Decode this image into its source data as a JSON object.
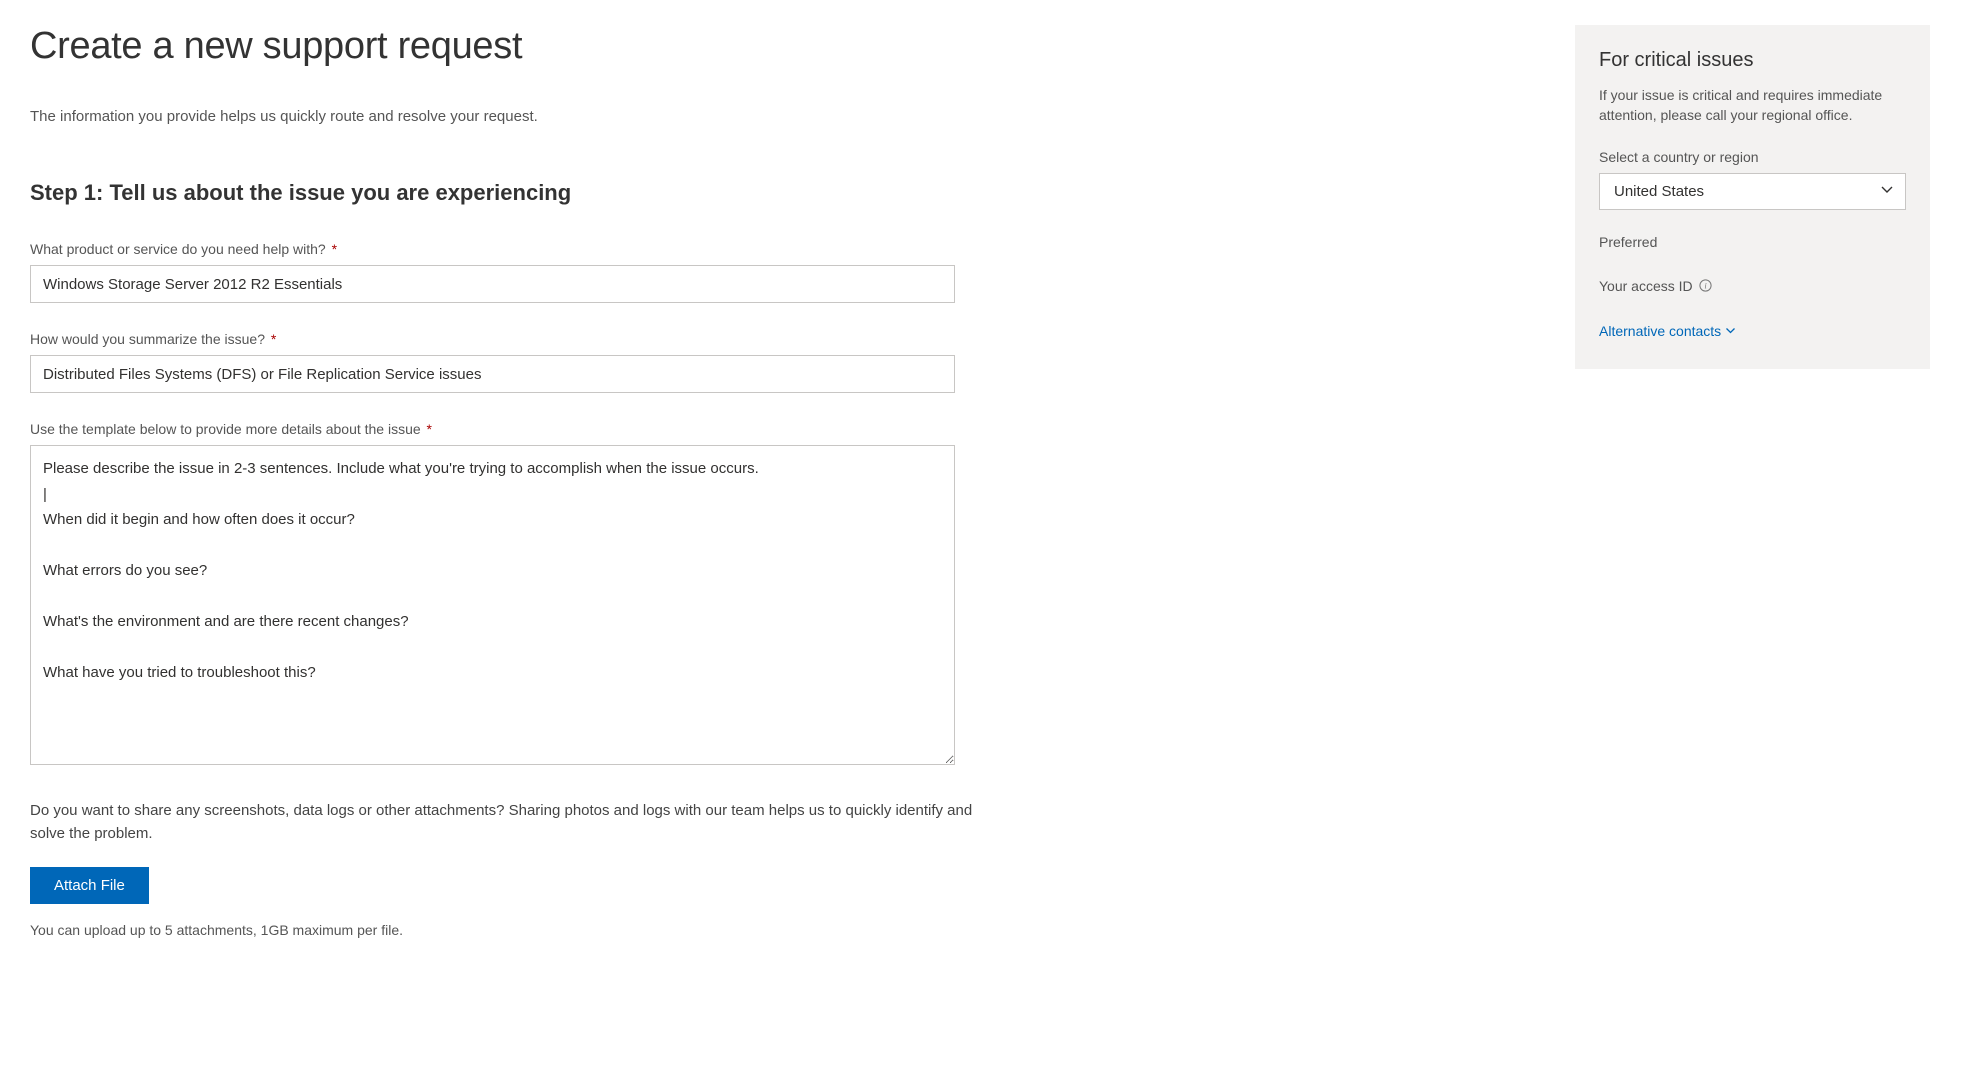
{
  "page": {
    "title": "Create a new support request",
    "subtitle": "The information you provide helps us quickly route and resolve your request."
  },
  "step1": {
    "heading": "Step 1: Tell us about the issue you are experiencing",
    "product": {
      "label": "What product or service do you need help with?",
      "value": "Windows Storage Server 2012 R2 Essentials"
    },
    "summary": {
      "label": "How would you summarize the issue?",
      "value": "Distributed Files Systems (DFS) or File Replication Service issues"
    },
    "details": {
      "label": "Use the template below to provide more details about the issue",
      "value": "Please describe the issue in 2-3 sentences. Include what you're trying to accomplish when the issue occurs.\n|\nWhen did it begin and how often does it occur?\n\nWhat errors do you see?\n\nWhat's the environment and are there recent changes?\n\nWhat have you tried to troubleshoot this?"
    },
    "attachment": {
      "prompt": "Do you want to share any screenshots, data logs or other attachments? Sharing photos and logs with our team helps us to quickly identify and solve the problem.",
      "button_label": "Attach File",
      "hint": "You can upload up to 5 attachments, 1GB maximum per file."
    }
  },
  "sidebar": {
    "title": "For critical issues",
    "text": "If your issue is critical and requires immediate attention, please call your regional office.",
    "country": {
      "label": "Select a country or region",
      "value": "United States"
    },
    "preferred_label": "Preferred",
    "access_id_label": "Your access ID",
    "alt_contacts_label": "Alternative contacts"
  }
}
